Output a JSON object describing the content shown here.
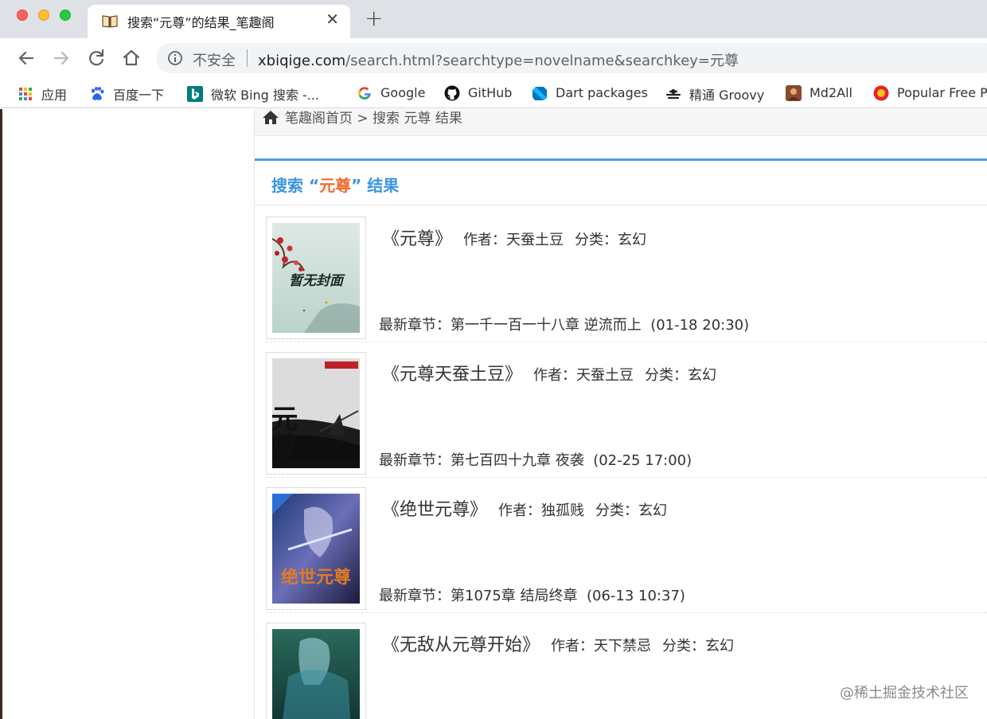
{
  "browser": {
    "tab": {
      "title": "搜索“元尊”的结果_笔趣阁",
      "favicon": "open-book-icon"
    },
    "omnibox": {
      "security_label": "不安全",
      "url_host": "xbiqige.com",
      "url_path": "/search.html?searchtype=novelname&searchkey=元尊"
    },
    "bookmarks": [
      {
        "label": "应用",
        "icon": "apps-grid-icon"
      },
      {
        "label": "百度一下",
        "icon": "baidu-paw-icon"
      },
      {
        "label": "微软 Bing 搜索 -...",
        "icon": "bing-icon"
      },
      {
        "label": "Google",
        "icon": "google-icon"
      },
      {
        "label": "GitHub",
        "icon": "github-icon"
      },
      {
        "label": "Dart packages",
        "icon": "dart-icon"
      },
      {
        "label": "精通 Groovy",
        "icon": "groovy-icon"
      },
      {
        "label": "Md2All",
        "icon": "md2all-icon"
      },
      {
        "label": "Popular Free P",
        "icon": "popular-free-icon"
      }
    ]
  },
  "page": {
    "breadcrumb": "笔趣阁首页 > 搜索 元尊 结果",
    "result_heading": {
      "prefix": "搜索 “",
      "keyword": "元尊",
      "suffix": "” 结果"
    },
    "books": [
      {
        "title": "《元尊》",
        "author": "作者：天蚕土豆",
        "category": "分类：玄幻",
        "latest": "最新章节：第一千一百一十八章 逆流而上",
        "time": "(01-18 20:30)",
        "cover_text": "暂无封面"
      },
      {
        "title": "《元尊天蚕土豆》",
        "author": "作者：天蚕土豆",
        "category": "分类：玄幻",
        "latest": "最新章节：第七百四十九章 夜袭",
        "time": "(02-25 17:00)",
        "cover_text": "元尊"
      },
      {
        "title": "《绝世元尊》",
        "author": "作者：独孤贱",
        "category": "分类：玄幻",
        "latest": "最新章节：第1075章 结局终章",
        "time": "(06-13 10:37)",
        "cover_text": "绝世元尊"
      },
      {
        "title": "《无敌从元尊开始》",
        "author": "作者：天下禁忌",
        "category": "分类：玄幻",
        "latest": "",
        "time": "",
        "cover_text": ""
      }
    ],
    "watermark": "@稀土掘金技术社区"
  }
}
